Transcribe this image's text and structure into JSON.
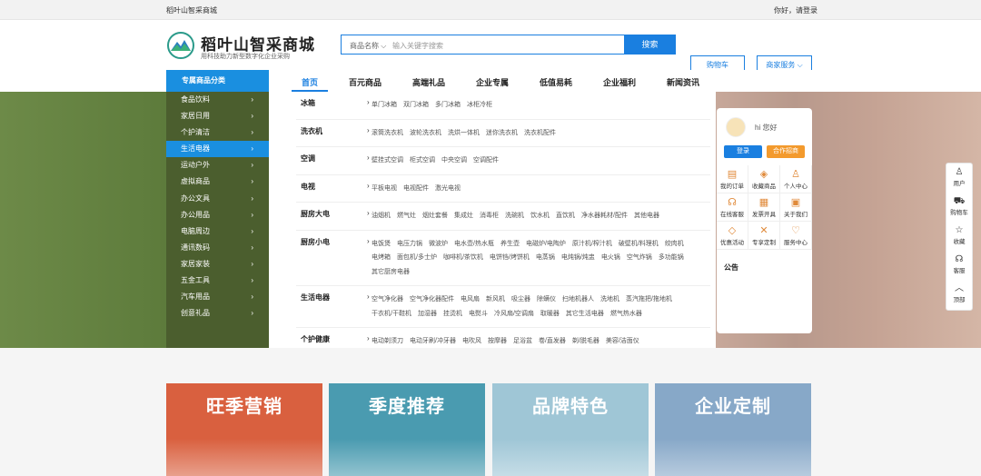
{
  "topbar": {
    "site_name": "稻叶山智采商城",
    "login_text": "你好，请登录"
  },
  "header": {
    "brand": "稻叶山智采商城",
    "slogan": "用科技助力新型数字化企业采购",
    "search": {
      "category": "商品名称 ⌵",
      "placeholder": "输入关键字搜索",
      "button": "搜索"
    },
    "cart_button": "购物车",
    "merchant_button": "商家服务 ⌵"
  },
  "nav": {
    "category_title": "专属商品分类",
    "items": [
      "首页",
      "百元商品",
      "高端礼品",
      "企业专属",
      "低值易耗",
      "企业福利",
      "新闻资讯"
    ]
  },
  "sidebar": {
    "items": [
      "食品饮料",
      "家居日用",
      "个护清洁",
      "生活电器",
      "运动户外",
      "虚拟商品",
      "办公文具",
      "办公用品",
      "电脑周边",
      "通讯数码",
      "家居家装",
      "五金工具",
      "汽车用品",
      "创意礼品"
    ],
    "arrow": "›"
  },
  "mega": {
    "arrow": "›",
    "rows": [
      {
        "label": "冰箱",
        "items": [
          "单门冰箱",
          "双门冰箱",
          "多门冰箱",
          "冰柜冷柜"
        ]
      },
      {
        "label": "洗衣机",
        "items": [
          "滚筒洗衣机",
          "波轮洗衣机",
          "洗烘一体机",
          "迷你洗衣机",
          "洗衣机配件"
        ]
      },
      {
        "label": "空调",
        "items": [
          "壁挂式空调",
          "柜式空调",
          "中央空调",
          "空调配件"
        ]
      },
      {
        "label": "电视",
        "items": [
          "平板电视",
          "电视配件",
          "激光电视"
        ]
      },
      {
        "label": "厨房大电",
        "items": [
          "油烟机",
          "燃气灶",
          "烟灶套餐",
          "集成灶",
          "消毒柜",
          "洗碗机",
          "饮水机",
          "直饮机",
          "净水器耗材/配件",
          "其他电器"
        ]
      },
      {
        "label": "厨房小电",
        "items": [
          "电饭煲",
          "电压力锅",
          "微波炉",
          "电水壶/热水瓶",
          "养生壶",
          "电磁炉/电陶炉",
          "原汁机/榨汁机",
          "破壁机/料理机",
          "绞肉机",
          "电烤箱",
          "面包机/多士炉",
          "咖啡机/茶饮机",
          "电饼铛/烤饼机",
          "电蒸锅",
          "电炖锅/炖盅",
          "电火锅",
          "空气炸锅",
          "多功能锅",
          "其它厨房电器"
        ]
      },
      {
        "label": "生活电器",
        "items": [
          "空气净化器",
          "空气净化器配件",
          "电风扇",
          "新风机",
          "吸尘器",
          "除螨仪",
          "扫地机器人",
          "洗地机",
          "蒸汽拖把/拖地机",
          "干衣机/干鞋机",
          "加湿器",
          "挂烫机",
          "电熨斗",
          "冷风扇/空调扇",
          "取暖器",
          "其它生活电器",
          "燃气热水器"
        ]
      },
      {
        "label": "个护健康",
        "items": [
          "电动剃须刀",
          "电动牙刷/冲牙器",
          "电吹风",
          "按摩器",
          "足浴盆",
          "卷/直发器",
          "剃/脱毛器",
          "美容/洁面仪"
        ]
      }
    ]
  },
  "user_card": {
    "greeting": "hi 您好",
    "login_button": "登录",
    "join_button": "合作招商",
    "grid": [
      {
        "icon": "order-icon",
        "glyph": "▤",
        "label": "我的订单"
      },
      {
        "icon": "favorite-icon",
        "glyph": "◈",
        "label": "收藏商品"
      },
      {
        "icon": "user-icon",
        "glyph": "♙",
        "label": "个人中心"
      },
      {
        "icon": "service-icon",
        "glyph": "☊",
        "label": "在线客服"
      },
      {
        "icon": "invoice-icon",
        "glyph": "▦",
        "label": "发票开具"
      },
      {
        "icon": "about-icon",
        "glyph": "▣",
        "label": "关于我们"
      },
      {
        "icon": "coupon-icon",
        "glyph": "◇",
        "label": "优惠活动"
      },
      {
        "icon": "custom-icon",
        "glyph": "✕",
        "label": "专享定制"
      },
      {
        "icon": "heart-icon",
        "glyph": "♡",
        "label": "服务中心"
      }
    ],
    "notice": "公告"
  },
  "float_bar": {
    "items": [
      {
        "icon": "user-icon",
        "glyph": "♙",
        "label": "用户"
      },
      {
        "icon": "cart-icon",
        "glyph": "⛟",
        "label": "购物车"
      },
      {
        "icon": "star-icon",
        "glyph": "☆",
        "label": "收藏"
      },
      {
        "icon": "headset-icon",
        "glyph": "☊",
        "label": "客服"
      },
      {
        "icon": "top-icon",
        "glyph": "︿",
        "label": "顶部"
      }
    ]
  },
  "promos": [
    {
      "title": "旺季营销",
      "color": "#d9603f"
    },
    {
      "title": "季度推荐",
      "color": "#4a9bb0"
    },
    {
      "title": "品牌特色",
      "color": "#9fc6d6"
    },
    {
      "title": "企业定制",
      "color": "#87a8c8"
    }
  ],
  "colors": {
    "accent": "#1a7fe0",
    "category_blue": "#1a8fe0",
    "orange": "#f39a2d"
  }
}
